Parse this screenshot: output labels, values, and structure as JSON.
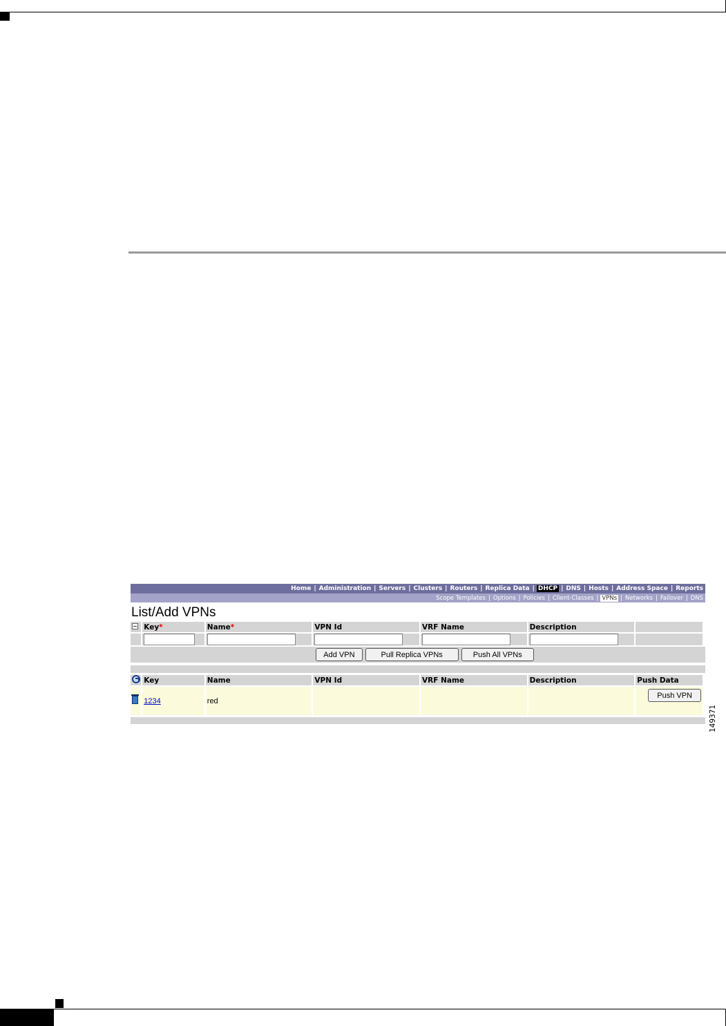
{
  "nav_primary": {
    "items": [
      "Home",
      "Administration",
      "Servers",
      "Clusters",
      "Routers",
      "Replica Data",
      "DHCP",
      "DNS",
      "Hosts",
      "Address Space",
      "Reports"
    ],
    "active": "DHCP"
  },
  "nav_secondary": {
    "items": [
      "Scope Templates",
      "Options",
      "Policies",
      "Client-Classes",
      "VPNs",
      "Networks",
      "Failover",
      "DNS"
    ],
    "active": "VPNs"
  },
  "page_title": "List/Add VPNs",
  "add_form": {
    "columns": {
      "key": "Key",
      "name": "Name",
      "vpn_id": "VPN Id",
      "vrf_name": "VRF Name",
      "description": "Description"
    },
    "required_mark": "*",
    "buttons": {
      "add": "Add VPN",
      "pull": "Pull Replica VPNs",
      "push_all": "Push All VPNs"
    }
  },
  "list": {
    "columns": {
      "key": "Key",
      "name": "Name",
      "vpn_id": "VPN Id",
      "vrf_name": "VRF Name",
      "description": "Description",
      "push_data": "Push Data"
    },
    "rows": [
      {
        "key": "1234",
        "name": "red",
        "vpn_id": "",
        "vrf_name": "",
        "description": "",
        "push_label": "Push VPN"
      }
    ]
  },
  "figure_number": "149371"
}
